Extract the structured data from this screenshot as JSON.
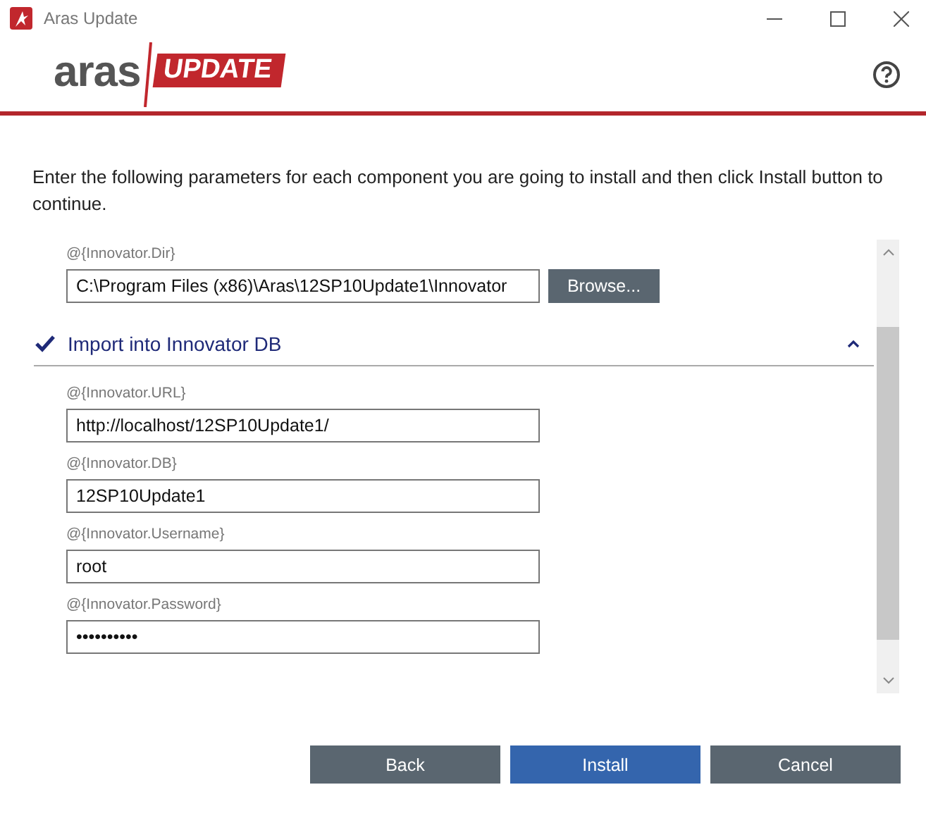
{
  "window": {
    "title": "Aras Update"
  },
  "logo": {
    "brand": "aras",
    "product": "UPDATE"
  },
  "intro": "Enter the following parameters for each component you are going to install and then click Install button to continue.",
  "fields_before": [
    {
      "label": "@{Innovator.Dir}",
      "value": "C:\\Program Files (x86)\\Aras\\12SP10Update1\\Innovator",
      "button": "Browse..."
    }
  ],
  "section": {
    "title": "Import into Innovator DB",
    "checked": true,
    "expanded": true,
    "fields": [
      {
        "label": "@{Innovator.URL}",
        "value": "http://localhost/12SP10Update1/"
      },
      {
        "label": "@{Innovator.DB}",
        "value": "12SP10Update1"
      },
      {
        "label": "@{Innovator.Username}",
        "value": "root"
      },
      {
        "label": "@{Innovator.Password}",
        "value": "••••••••••"
      }
    ]
  },
  "buttons": [
    {
      "label": "Back",
      "kind": "secondary"
    },
    {
      "label": "Install",
      "kind": "primary"
    },
    {
      "label": "Cancel",
      "kind": "secondary"
    }
  ]
}
